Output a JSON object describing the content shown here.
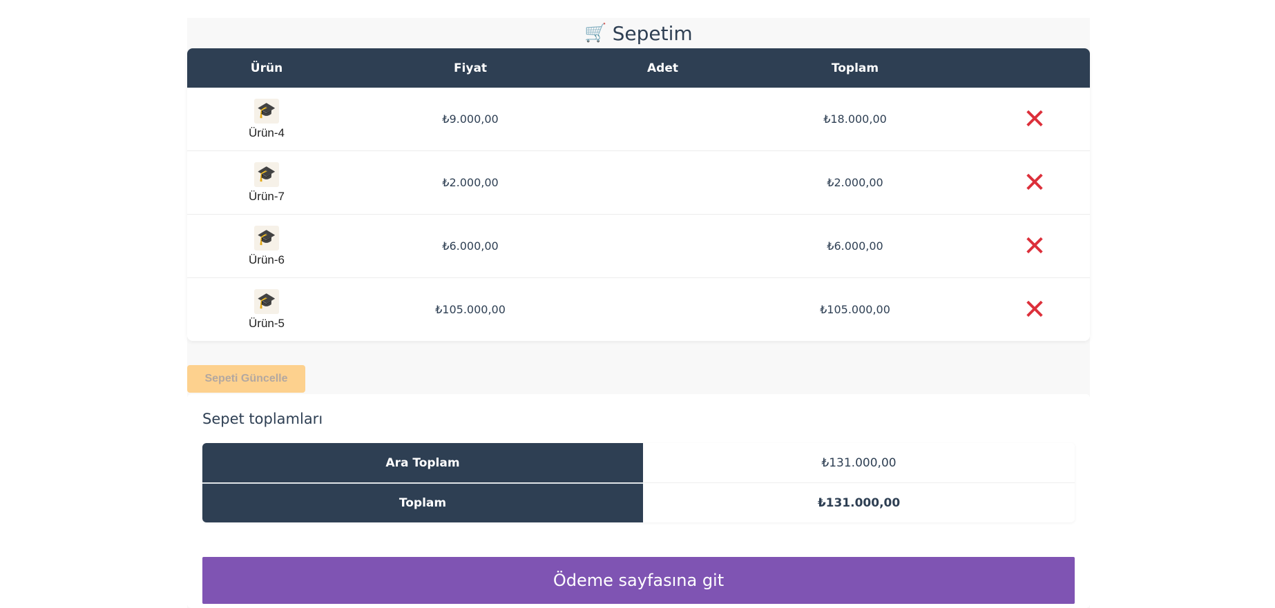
{
  "cart": {
    "title": "Sepetim",
    "title_icon": "shopping-cart-icon",
    "columns": {
      "product": "Ürün",
      "price": "Fiyat",
      "quantity": "Adet",
      "total": "Toplam"
    },
    "items": [
      {
        "name": "Ürün-4",
        "price": "₺9.000,00",
        "total": "₺18.000,00",
        "icon": "graduation-cap-icon",
        "remove_icon": "close-icon"
      },
      {
        "name": "Ürün-7",
        "price": "₺2.000,00",
        "total": "₺2.000,00",
        "icon": "graduation-cap-icon",
        "remove_icon": "close-icon"
      },
      {
        "name": "Ürün-6",
        "price": "₺6.000,00",
        "total": "₺6.000,00",
        "icon": "graduation-cap-icon",
        "remove_icon": "close-icon"
      },
      {
        "name": "Ürün-5",
        "price": "₺105.000,00",
        "total": "₺105.000,00",
        "icon": "graduation-cap-icon",
        "remove_icon": "close-icon"
      }
    ],
    "update_button": "Sepeti Güncelle"
  },
  "totals": {
    "title": "Sepet toplamları",
    "subtotal_label": "Ara Toplam",
    "subtotal_value": "₺131.000,00",
    "total_label": "Toplam",
    "total_value": "₺131.000,00",
    "checkout_button": "Ödeme sayfasına git"
  },
  "colors": {
    "header_bg": "#2e3f53",
    "remove_red": "#dc2f3a",
    "update_button_bg": "#fdd18e",
    "checkout_button_bg": "#7f54b3"
  }
}
